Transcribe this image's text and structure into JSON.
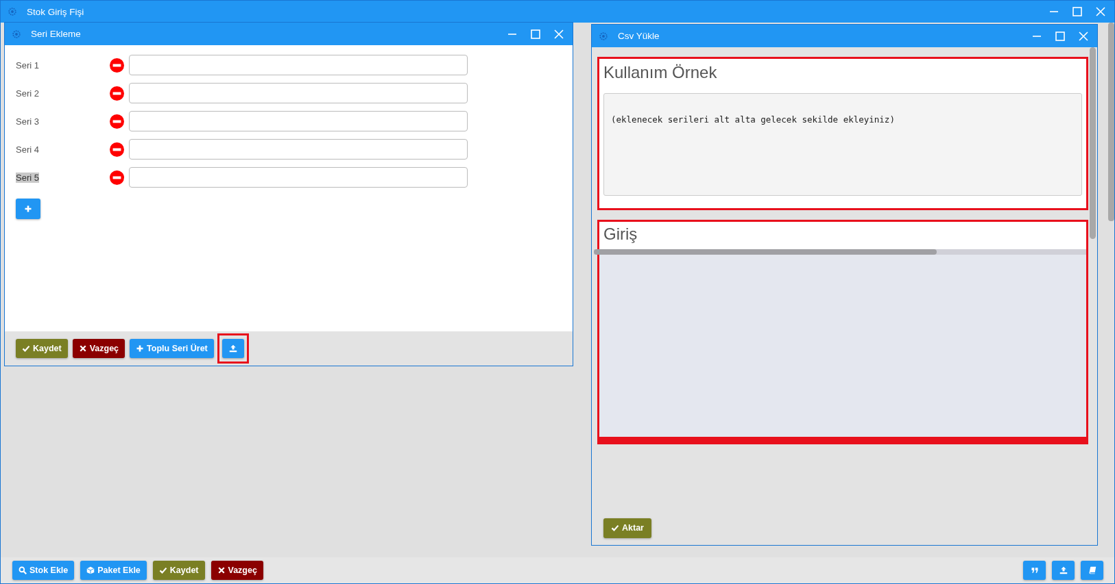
{
  "main_window": {
    "title": "Stok Giriş Fişi"
  },
  "seri_window": {
    "title": "Seri Ekleme",
    "rows": [
      {
        "label": "Seri 1",
        "highlighted": false
      },
      {
        "label": "Seri 2",
        "highlighted": false
      },
      {
        "label": "Seri 3",
        "highlighted": false
      },
      {
        "label": "Seri 4",
        "highlighted": false
      },
      {
        "label": "Seri 5",
        "highlighted": true
      }
    ],
    "add_button": {
      "kind": "add"
    },
    "footer_buttons": [
      {
        "kind": "save",
        "label": "Kaydet",
        "highlighted": false
      },
      {
        "kind": "cancel",
        "label": "Vazgeç",
        "highlighted": false
      },
      {
        "kind": "add",
        "label": "Toplu Seri Üret",
        "highlighted": false
      },
      {
        "kind": "upload",
        "highlighted": true
      }
    ]
  },
  "csv_window": {
    "title": "Csv Yükle",
    "sections": [
      {
        "kind": "example",
        "heading": "Kullanım Örnek",
        "text": "(eklenecek serileri alt alta gelecek sekilde ekleyiniz)",
        "highlighted": true
      },
      {
        "kind": "input",
        "heading": "Giriş",
        "highlighted": true
      }
    ],
    "button": {
      "kind": "save",
      "label": "Aktar"
    }
  },
  "bottom_bar": {
    "left_buttons": [
      {
        "kind": "search",
        "label": "Stok Ekle"
      },
      {
        "kind": "package",
        "label": "Paket Ekle"
      },
      {
        "kind": "save",
        "label": "Kaydet"
      },
      {
        "kind": "cancel",
        "label": "Vazgeç"
      }
    ],
    "right_buttons": [
      {
        "kind": "quote"
      },
      {
        "kind": "upload"
      },
      {
        "kind": "book"
      }
    ]
  }
}
